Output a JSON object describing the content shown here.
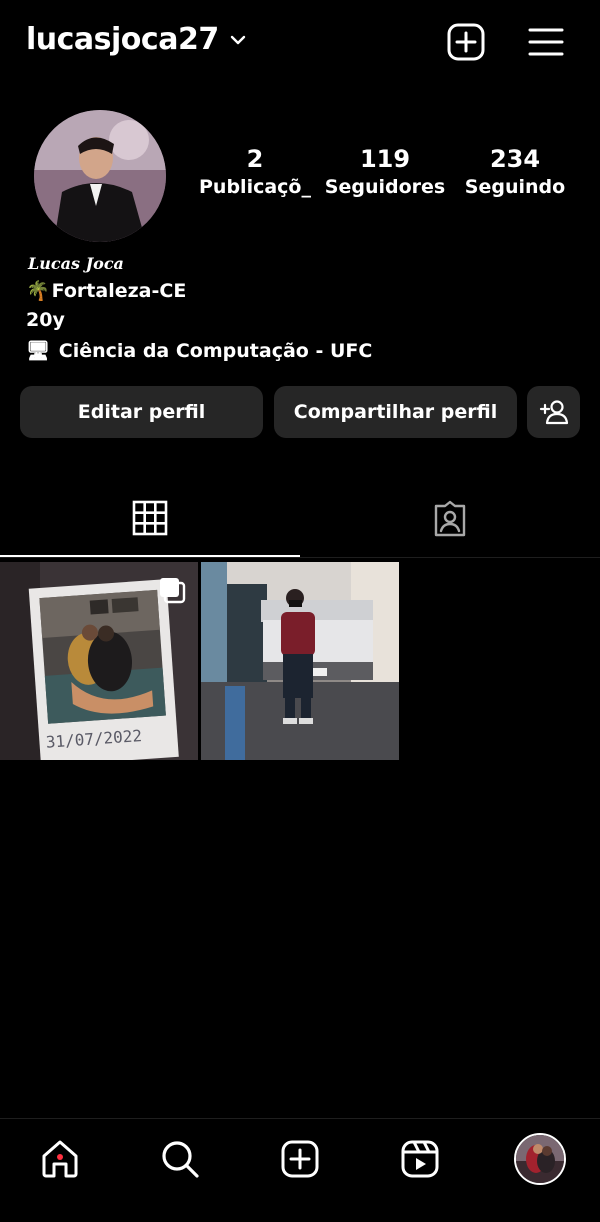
{
  "header": {
    "username": "lucasjoca27",
    "icons": [
      "chevron-down-icon",
      "new-post-icon",
      "menu-icon"
    ]
  },
  "profile": {
    "stats": [
      {
        "value": "2",
        "label": "Publicaçõ_"
      },
      {
        "value": "119",
        "label": "Seguidores"
      },
      {
        "value": "234",
        "label": "Seguindo"
      }
    ],
    "fullname": "Lucas Joca",
    "bio": {
      "line1_emoji": "🌴",
      "line1": "Fortaleza-CE",
      "line2": "20y",
      "line3_emoji": "🖥",
      "line3": "Ciência da Computação - UFC"
    }
  },
  "buttons": {
    "edit": "Editar perfil",
    "share": "Compartilhar perfil"
  },
  "tabs": [
    "grid-icon",
    "tagged-icon"
  ],
  "posts": [
    {
      "caption_text": "31/07/2022",
      "multi": true
    },
    {
      "multi": false
    }
  ],
  "nav": [
    "home-icon",
    "search-icon",
    "create-icon",
    "reels-icon",
    "profile-avatar"
  ],
  "colors": {
    "background": "#000000",
    "button": "#262626",
    "notification": "#ff3040"
  }
}
